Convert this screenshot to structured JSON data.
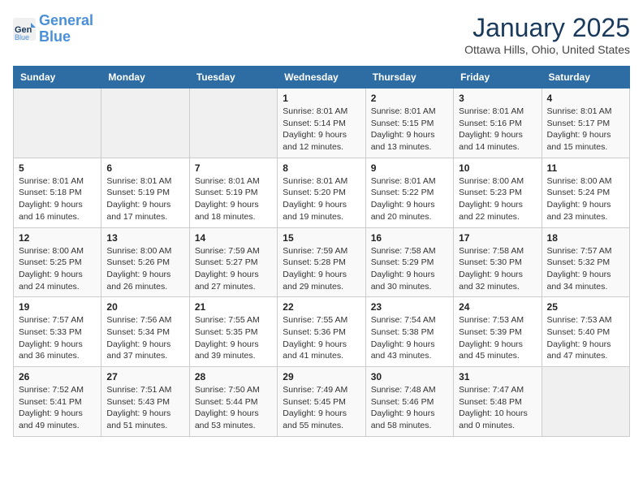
{
  "header": {
    "logo_line1": "General",
    "logo_line2": "Blue",
    "month": "January 2025",
    "location": "Ottawa Hills, Ohio, United States"
  },
  "weekdays": [
    "Sunday",
    "Monday",
    "Tuesday",
    "Wednesday",
    "Thursday",
    "Friday",
    "Saturday"
  ],
  "weeks": [
    [
      {
        "day": "",
        "info": ""
      },
      {
        "day": "",
        "info": ""
      },
      {
        "day": "",
        "info": ""
      },
      {
        "day": "1",
        "info": "Sunrise: 8:01 AM\nSunset: 5:14 PM\nDaylight: 9 hours and 12 minutes."
      },
      {
        "day": "2",
        "info": "Sunrise: 8:01 AM\nSunset: 5:15 PM\nDaylight: 9 hours and 13 minutes."
      },
      {
        "day": "3",
        "info": "Sunrise: 8:01 AM\nSunset: 5:16 PM\nDaylight: 9 hours and 14 minutes."
      },
      {
        "day": "4",
        "info": "Sunrise: 8:01 AM\nSunset: 5:17 PM\nDaylight: 9 hours and 15 minutes."
      }
    ],
    [
      {
        "day": "5",
        "info": "Sunrise: 8:01 AM\nSunset: 5:18 PM\nDaylight: 9 hours and 16 minutes."
      },
      {
        "day": "6",
        "info": "Sunrise: 8:01 AM\nSunset: 5:19 PM\nDaylight: 9 hours and 17 minutes."
      },
      {
        "day": "7",
        "info": "Sunrise: 8:01 AM\nSunset: 5:19 PM\nDaylight: 9 hours and 18 minutes."
      },
      {
        "day": "8",
        "info": "Sunrise: 8:01 AM\nSunset: 5:20 PM\nDaylight: 9 hours and 19 minutes."
      },
      {
        "day": "9",
        "info": "Sunrise: 8:01 AM\nSunset: 5:22 PM\nDaylight: 9 hours and 20 minutes."
      },
      {
        "day": "10",
        "info": "Sunrise: 8:00 AM\nSunset: 5:23 PM\nDaylight: 9 hours and 22 minutes."
      },
      {
        "day": "11",
        "info": "Sunrise: 8:00 AM\nSunset: 5:24 PM\nDaylight: 9 hours and 23 minutes."
      }
    ],
    [
      {
        "day": "12",
        "info": "Sunrise: 8:00 AM\nSunset: 5:25 PM\nDaylight: 9 hours and 24 minutes."
      },
      {
        "day": "13",
        "info": "Sunrise: 8:00 AM\nSunset: 5:26 PM\nDaylight: 9 hours and 26 minutes."
      },
      {
        "day": "14",
        "info": "Sunrise: 7:59 AM\nSunset: 5:27 PM\nDaylight: 9 hours and 27 minutes."
      },
      {
        "day": "15",
        "info": "Sunrise: 7:59 AM\nSunset: 5:28 PM\nDaylight: 9 hours and 29 minutes."
      },
      {
        "day": "16",
        "info": "Sunrise: 7:58 AM\nSunset: 5:29 PM\nDaylight: 9 hours and 30 minutes."
      },
      {
        "day": "17",
        "info": "Sunrise: 7:58 AM\nSunset: 5:30 PM\nDaylight: 9 hours and 32 minutes."
      },
      {
        "day": "18",
        "info": "Sunrise: 7:57 AM\nSunset: 5:32 PM\nDaylight: 9 hours and 34 minutes."
      }
    ],
    [
      {
        "day": "19",
        "info": "Sunrise: 7:57 AM\nSunset: 5:33 PM\nDaylight: 9 hours and 36 minutes."
      },
      {
        "day": "20",
        "info": "Sunrise: 7:56 AM\nSunset: 5:34 PM\nDaylight: 9 hours and 37 minutes."
      },
      {
        "day": "21",
        "info": "Sunrise: 7:55 AM\nSunset: 5:35 PM\nDaylight: 9 hours and 39 minutes."
      },
      {
        "day": "22",
        "info": "Sunrise: 7:55 AM\nSunset: 5:36 PM\nDaylight: 9 hours and 41 minutes."
      },
      {
        "day": "23",
        "info": "Sunrise: 7:54 AM\nSunset: 5:38 PM\nDaylight: 9 hours and 43 minutes."
      },
      {
        "day": "24",
        "info": "Sunrise: 7:53 AM\nSunset: 5:39 PM\nDaylight: 9 hours and 45 minutes."
      },
      {
        "day": "25",
        "info": "Sunrise: 7:53 AM\nSunset: 5:40 PM\nDaylight: 9 hours and 47 minutes."
      }
    ],
    [
      {
        "day": "26",
        "info": "Sunrise: 7:52 AM\nSunset: 5:41 PM\nDaylight: 9 hours and 49 minutes."
      },
      {
        "day": "27",
        "info": "Sunrise: 7:51 AM\nSunset: 5:43 PM\nDaylight: 9 hours and 51 minutes."
      },
      {
        "day": "28",
        "info": "Sunrise: 7:50 AM\nSunset: 5:44 PM\nDaylight: 9 hours and 53 minutes."
      },
      {
        "day": "29",
        "info": "Sunrise: 7:49 AM\nSunset: 5:45 PM\nDaylight: 9 hours and 55 minutes."
      },
      {
        "day": "30",
        "info": "Sunrise: 7:48 AM\nSunset: 5:46 PM\nDaylight: 9 hours and 58 minutes."
      },
      {
        "day": "31",
        "info": "Sunrise: 7:47 AM\nSunset: 5:48 PM\nDaylight: 10 hours and 0 minutes."
      },
      {
        "day": "",
        "info": ""
      }
    ]
  ]
}
